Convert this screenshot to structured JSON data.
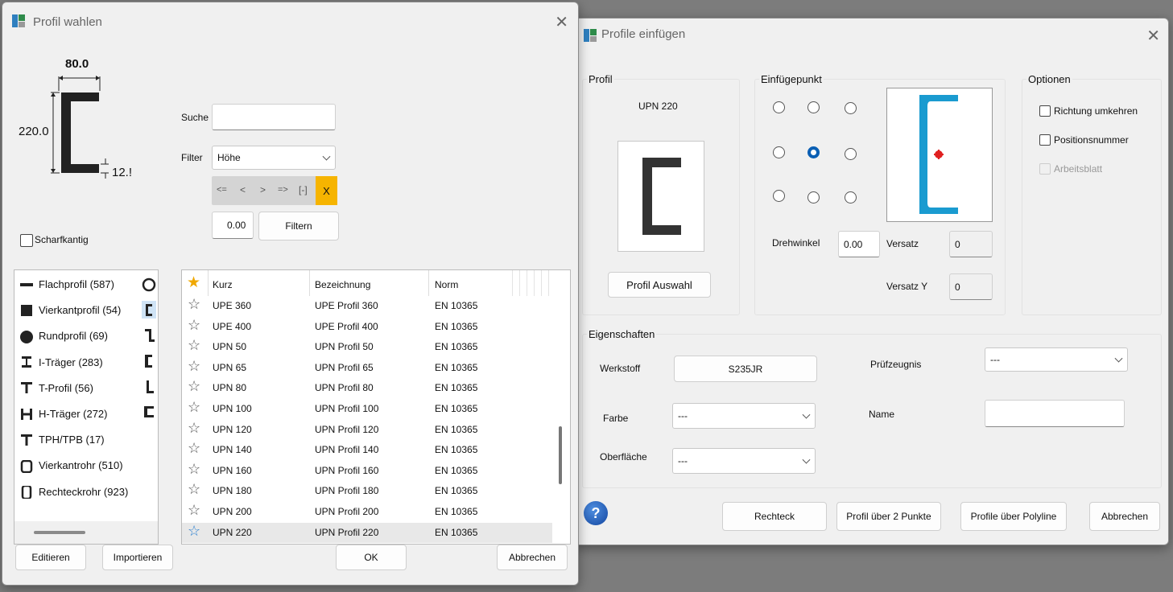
{
  "left_dialog": {
    "title": "Profil wahlen",
    "dims": {
      "width": "80.0",
      "height": "220.0",
      "thickness": "12.!"
    },
    "search_label": "Suche",
    "search_value": "",
    "filter_label": "Filter",
    "filter_value": "Höhe",
    "nav": {
      "first": "<=",
      "prev": "<",
      "next": ">",
      "last": "=>",
      "bracket": "[-]",
      "clear": "X"
    },
    "filter_number": "0.00",
    "filter_button": "Filtern",
    "sharp_edge_label": "Scharfkantig",
    "categories": [
      {
        "label": "Flachprofil (587)",
        "icon": "flat-bar-icon"
      },
      {
        "label": "Vierkantprofil (54)",
        "icon": "square-bar-icon"
      },
      {
        "label": "Rundprofil (69)",
        "icon": "round-bar-icon"
      },
      {
        "label": "I-Träger (283)",
        "icon": "i-beam-icon"
      },
      {
        "label": "T-Profil (56)",
        "icon": "t-profile-icon"
      },
      {
        "label": "H-Träger (272)",
        "icon": "h-beam-icon"
      },
      {
        "label": "TPH/TPB (17)",
        "icon": "tph-icon"
      },
      {
        "label": "Vierkantrohr (510)",
        "icon": "square-tube-icon"
      },
      {
        "label": "Rechteckrohr (923)",
        "icon": "rect-tube-icon"
      }
    ],
    "side_icons": [
      "round-tube-icon",
      "c-profile-icon",
      "z-profile-icon",
      "u-profile-icon",
      "l-profile-icon",
      "hat-profile-icon"
    ],
    "table": {
      "headers": [
        "Kurz",
        "Bezeichnung",
        "Norm"
      ],
      "rows": [
        {
          "kurz": "UPE 360",
          "bez": "UPE Profil 360",
          "norm": "EN 10365"
        },
        {
          "kurz": "UPE 400",
          "bez": "UPE Profil 400",
          "norm": "EN 10365"
        },
        {
          "kurz": "UPN 50",
          "bez": "UPN Profil 50",
          "norm": "EN 10365"
        },
        {
          "kurz": "UPN 65",
          "bez": "UPN Profil 65",
          "norm": "EN 10365"
        },
        {
          "kurz": "UPN 80",
          "bez": "UPN Profil 80",
          "norm": "EN 10365"
        },
        {
          "kurz": "UPN 100",
          "bez": "UPN Profil 100",
          "norm": "EN 10365"
        },
        {
          "kurz": "UPN 120",
          "bez": "UPN Profil 120",
          "norm": "EN 10365"
        },
        {
          "kurz": "UPN 140",
          "bez": "UPN Profil 140",
          "norm": "EN 10365"
        },
        {
          "kurz": "UPN 160",
          "bez": "UPN Profil 160",
          "norm": "EN 10365"
        },
        {
          "kurz": "UPN 180",
          "bez": "UPN Profil 180",
          "norm": "EN 10365"
        },
        {
          "kurz": "UPN 200",
          "bez": "UPN Profil 200",
          "norm": "EN 10365"
        },
        {
          "kurz": "UPN 220",
          "bez": "UPN Profil 220",
          "norm": "EN 10365"
        }
      ]
    },
    "buttons": {
      "edit": "Editieren",
      "import": "Importieren",
      "ok": "OK",
      "cancel": "Abbrechen"
    }
  },
  "right_dialog": {
    "title": "Profile einfügen",
    "profil_group": "Profil",
    "profil_name": "UPN 220",
    "profil_button": "Profil Auswahl",
    "einfuege_group": "Einfügepunkt",
    "drehwinkel_label": "Drehwinkel",
    "drehwinkel_value": "0.00",
    "versatz_label": "Versatz",
    "versatz_value": "0",
    "versatz_y_label": "Versatz Y",
    "versatz_y_value": "0",
    "optionen_group": "Optionen",
    "options": [
      "Richtung umkehren",
      "Positionsnummer",
      "Arbeitsblatt"
    ],
    "eigenschaften_group": "Eigenschaften",
    "werkstoff_label": "Werkstoff",
    "werkstoff_value": "S235JR",
    "farbe_label": "Farbe",
    "farbe_value": "---",
    "oberflaeche_label": "Oberfläche",
    "oberflaeche_value": "---",
    "pruef_label": "Prüfzeugnis",
    "pruef_value": "---",
    "name_label": "Name",
    "name_value": "",
    "help": "?",
    "buttons": {
      "rechteck": "Rechteck",
      "zwei_punkte": "Profil über 2 Punkte",
      "polyline": "Profile über Polyline",
      "cancel": "Abbrechen"
    },
    "accent": "#1a9bd0"
  }
}
